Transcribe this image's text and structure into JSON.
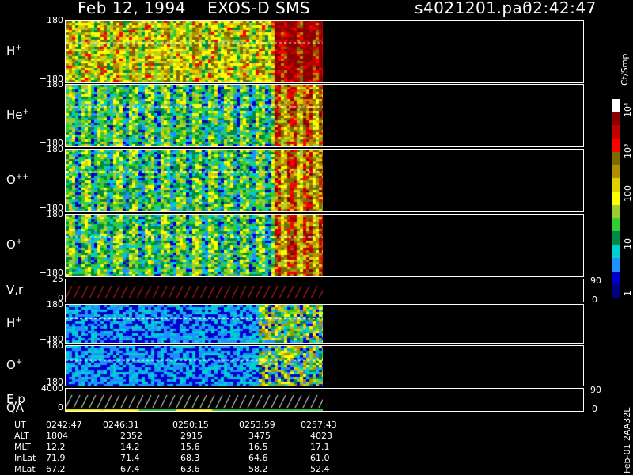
{
  "header": {
    "date": "Feb 12, 1994",
    "instrument": "EXOS-D SMS",
    "file": "s4021201.par",
    "time": "02:42:47"
  },
  "panels": [
    {
      "label": "H",
      "ion": "+",
      "top_tick": "180",
      "bottom_tick": "−180"
    },
    {
      "label": "He",
      "ion": "+",
      "top_tick": "180",
      "bottom_tick": "−180"
    },
    {
      "label": "O",
      "ion": "++",
      "top_tick": "180",
      "bottom_tick": "−180"
    },
    {
      "label": "O",
      "ion": "+",
      "top_tick": "180",
      "bottom_tick": "−180"
    },
    {
      "label": "V,r",
      "ion": "",
      "top_tick": "25",
      "bottom_tick": "0",
      "right_top": "90",
      "right_bottom": "0"
    },
    {
      "label": "H",
      "ion": "+",
      "top_tick": "180",
      "bottom_tick": "−180"
    },
    {
      "label": "O",
      "ion": "+",
      "top_tick": "180",
      "bottom_tick": "−180"
    },
    {
      "label": "E,p",
      "ion": "",
      "top_tick": "4000",
      "bottom_tick": "0",
      "right_top": "90",
      "right_bottom": "0",
      "label2": "QA"
    }
  ],
  "colorbar": {
    "unit": "Ct/Smp",
    "ticks": [
      "10⁴",
      "10³",
      "100",
      "10",
      "1"
    ],
    "colors": [
      "#ffffff",
      "#8b0000",
      "#c00000",
      "#ff0000",
      "#7a6a00",
      "#b09000",
      "#e0d000",
      "#ffff00",
      "#9acd32",
      "#32cd32",
      "#008b45",
      "#00ced1",
      "#1e90ff",
      "#0000cd",
      "#000080"
    ]
  },
  "side_label": "Feb-01 2AA32L",
  "ut_table": {
    "rows": [
      "UT",
      "ALT",
      "MLT",
      "InLat",
      "MLat"
    ],
    "columns": [
      [
        "0242:47",
        "1804",
        "12.2",
        "71.9",
        "67.2"
      ],
      [
        "0246:31",
        "2352",
        "14.2",
        "71.4",
        "67.4"
      ],
      [
        "0250:15",
        "2915",
        "15.6",
        "68.3",
        "63.6"
      ],
      [
        "0253:59",
        "3475",
        "16.5",
        "64.6",
        "58.2"
      ],
      [
        "0257:43",
        "4023",
        "17.1",
        "61.0",
        "52.4"
      ]
    ]
  },
  "chart_data": {
    "type": "heatmap",
    "title": "Feb 12, 1994   EXOS-D SMS",
    "x_ticks": [
      "0242:47",
      "0246:31",
      "0250:15",
      "0253:59",
      "0257:43"
    ],
    "data_fraction_of_axis": 0.495,
    "series": [
      {
        "name": "H+",
        "ylim": [
          -180,
          180
        ]
      },
      {
        "name": "He+",
        "ylim": [
          -180,
          180
        ]
      },
      {
        "name": "O++",
        "ylim": [
          -180,
          180
        ]
      },
      {
        "name": "O+",
        "ylim": [
          -180,
          180
        ]
      },
      {
        "name": "V,r",
        "ylim": [
          0,
          25
        ]
      },
      {
        "name": "H+",
        "ylim": [
          -180,
          180
        ]
      },
      {
        "name": "O+",
        "ylim": [
          -180,
          180
        ]
      },
      {
        "name": "E,p",
        "ylim": [
          0,
          4000
        ]
      }
    ],
    "colorbar_scale": "log",
    "colorbar_range": [
      1,
      10000
    ]
  }
}
